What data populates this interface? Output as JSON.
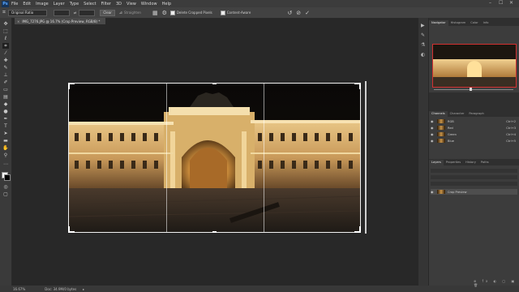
{
  "menubar": {
    "logo": "Ps",
    "items": [
      "File",
      "Edit",
      "Image",
      "Layer",
      "Type",
      "Select",
      "Filter",
      "3D",
      "View",
      "Window",
      "Help"
    ],
    "window_controls": [
      "–",
      "☐",
      "✕"
    ]
  },
  "options": {
    "ratio_value": "Original Ratio",
    "clear_label": "Clear",
    "straighten_label": "Straighten",
    "delete_cropped_label": "Delete Cropped Pixels",
    "content_aware_label": "Content-Aware"
  },
  "document": {
    "tab_title": "IMG_7276.JPG @ 16.7% (Crop Preview, RGB/8) *",
    "close_glyph": "×"
  },
  "status": {
    "zoom": "16.67%",
    "doc_info": "Doc: 34.9M/0 bytes"
  },
  "navigator": {
    "tabs": [
      "Navigator",
      "Histogram",
      "Color",
      "Info"
    ]
  },
  "channels": {
    "tabs": [
      "Channels",
      "Character",
      "Paragraph"
    ],
    "rows": [
      {
        "name": "RGB",
        "shortcut": "Ctrl+2"
      },
      {
        "name": "Red",
        "shortcut": "Ctrl+3"
      },
      {
        "name": "Green",
        "shortcut": "Ctrl+4"
      },
      {
        "name": "Blue",
        "shortcut": "Ctrl+5"
      }
    ]
  },
  "layers": {
    "tabs": [
      "Layers",
      "Properties",
      "History",
      "Paths"
    ],
    "layer_name": "Crop Preview"
  },
  "colors": {
    "accent": "#2d8ceb",
    "panel_bg": "#3c3c3c",
    "canvas_bg": "#282828"
  },
  "icons": [
    "move-icon",
    "marquee-icon",
    "lasso-icon",
    "crop-icon",
    "eyedropper-icon",
    "healing-icon",
    "brush-icon",
    "stamp-icon",
    "history-brush-icon",
    "eraser-icon",
    "gradient-icon",
    "blur-icon",
    "dodge-icon",
    "pen-icon",
    "type-icon",
    "path-select-icon",
    "shape-icon",
    "hand-icon",
    "zoom-icon"
  ]
}
